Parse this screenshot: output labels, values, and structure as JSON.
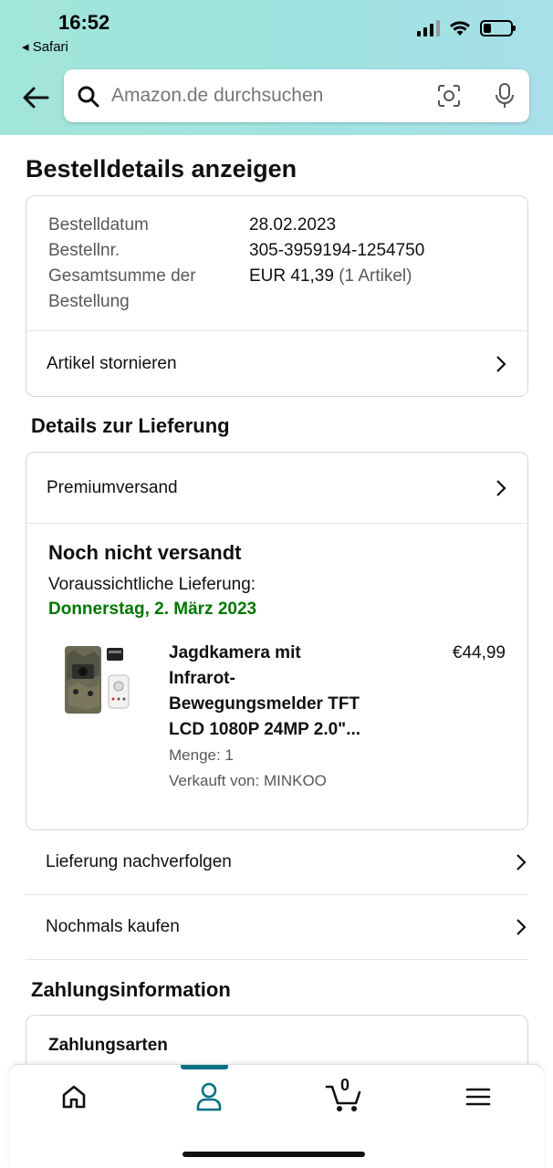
{
  "status": {
    "time": "16:52",
    "back_app": "◂ Safari"
  },
  "search": {
    "placeholder": "Amazon.de durchsuchen"
  },
  "page_title": "Bestelldetails anzeigen",
  "order": {
    "date_label": "Bestelldatum",
    "date_value": "28.02.2023",
    "number_label": "Bestellnr.",
    "number_value": "305-3959194-1254750",
    "total_label_1": "Gesamtsumme der",
    "total_label_2": "Bestellung",
    "total_value": "EUR 41,39",
    "total_items": "(1 Artikel)",
    "cancel_label": "Artikel stornieren"
  },
  "delivery": {
    "heading": "Details zur Lieferung",
    "shipping_label": "Premiumversand",
    "status": "Noch nicht versandt",
    "expected_label": "Voraussichtliche Lieferung:",
    "expected_date": "Donnerstag, 2. März 2023",
    "item": {
      "title_lines": [
        "Jagdkamera mit",
        "Infrarot-",
        "Bewegungsmelder TFT",
        "LCD 1080P 24MP 2.0\"..."
      ],
      "price": "€44,99",
      "quantity": "Menge: 1",
      "seller": "Verkauft von: MINKOO"
    },
    "track_label": "Lieferung nachverfolgen",
    "buy_again_label": "Nochmals kaufen"
  },
  "payment": {
    "heading": "Zahlungsinformation",
    "methods_label": "Zahlungsarten"
  },
  "nav": {
    "cart_count": "0",
    "active": "account"
  },
  "colors": {
    "accent": "#007185",
    "green": "#007600",
    "header_bg": "#a2e5d9"
  }
}
